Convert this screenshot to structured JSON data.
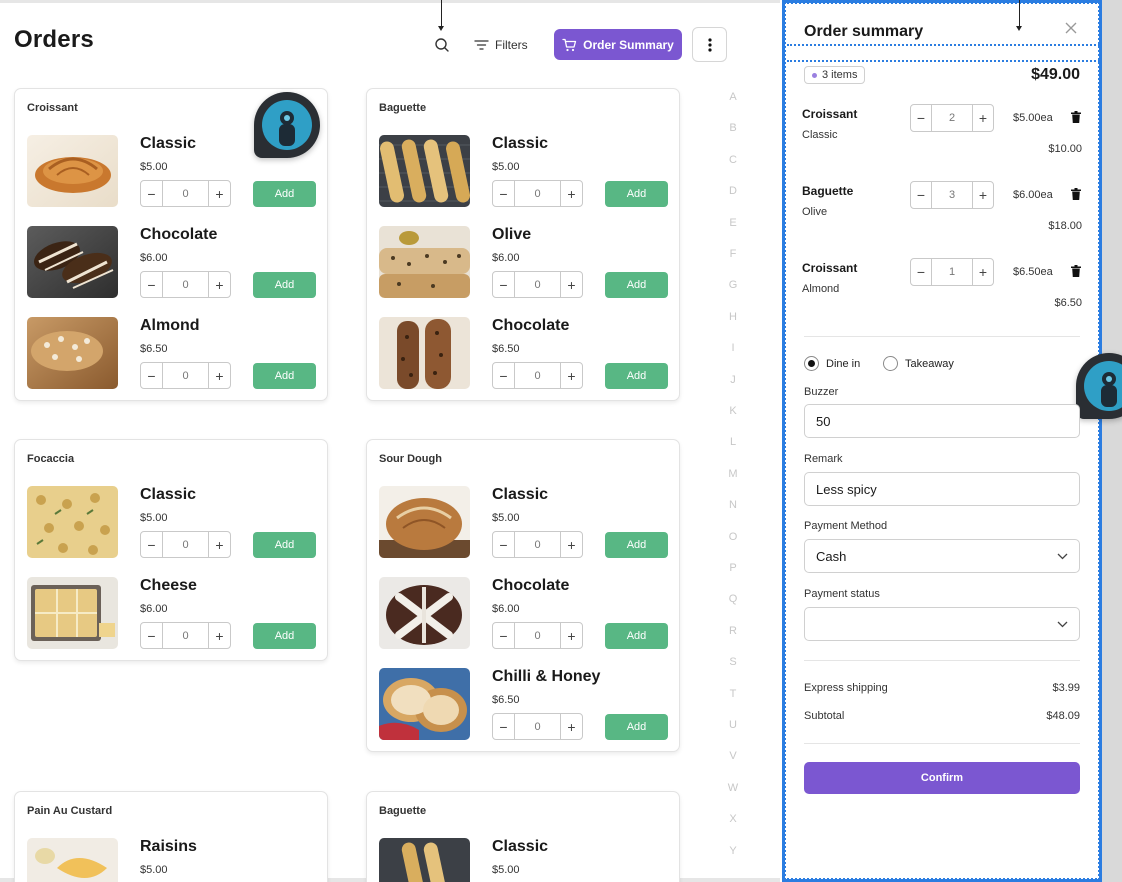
{
  "header": {
    "title": "Orders",
    "filters_label": "Filters",
    "summary_button_label": "Order Summary"
  },
  "categories": [
    {
      "title": "Croissant",
      "items": [
        {
          "name": "Classic",
          "price": "$5.00",
          "qty": "0",
          "add": "Add"
        },
        {
          "name": "Chocolate",
          "price": "$6.00",
          "qty": "0",
          "add": "Add"
        },
        {
          "name": "Almond",
          "price": "$6.50",
          "qty": "0",
          "add": "Add"
        }
      ]
    },
    {
      "title": "Baguette",
      "items": [
        {
          "name": "Classic",
          "price": "$5.00",
          "qty": "0",
          "add": "Add"
        },
        {
          "name": "Olive",
          "price": "$6.00",
          "qty": "0",
          "add": "Add"
        },
        {
          "name": "Chocolate",
          "price": "$6.50",
          "qty": "0",
          "add": "Add"
        }
      ]
    },
    {
      "title": "Focaccia",
      "items": [
        {
          "name": "Classic",
          "price": "$5.00",
          "qty": "0",
          "add": "Add"
        },
        {
          "name": "Cheese",
          "price": "$6.00",
          "qty": "0",
          "add": "Add"
        }
      ]
    },
    {
      "title": "Sour Dough",
      "items": [
        {
          "name": "Classic",
          "price": "$5.00",
          "qty": "0",
          "add": "Add"
        },
        {
          "name": "Chocolate",
          "price": "$6.00",
          "qty": "0",
          "add": "Add"
        },
        {
          "name": "Chilli & Honey",
          "price": "$6.50",
          "qty": "0",
          "add": "Add"
        }
      ]
    },
    {
      "title": "Pain Au Custard",
      "items": [
        {
          "name": "Raisins",
          "price": "$5.00"
        }
      ]
    },
    {
      "title": "Baguette",
      "items": [
        {
          "name": "Classic",
          "price": "$5.00"
        }
      ]
    }
  ],
  "alphabet": [
    "A",
    "B",
    "C",
    "D",
    "E",
    "F",
    "G",
    "H",
    "I",
    "J",
    "K",
    "L",
    "M",
    "N",
    "O",
    "P",
    "Q",
    "R",
    "S",
    "T",
    "U",
    "V",
    "W",
    "X",
    "Y"
  ],
  "order_summary": {
    "title": "Order summary",
    "items_badge": "3 items",
    "total": "$49.00",
    "lines": [
      {
        "name": "Croissant",
        "variant": "Classic",
        "qty": "2",
        "each": "$5.00ea",
        "line_total": "$10.00"
      },
      {
        "name": "Baguette",
        "variant": "Olive",
        "qty": "3",
        "each": "$6.00ea",
        "line_total": "$18.00"
      },
      {
        "name": "Croissant",
        "variant": "Almond",
        "qty": "1",
        "each": "$6.50ea",
        "line_total": "$6.50"
      }
    ],
    "dine_in_label": "Dine in",
    "takeaway_label": "Takeaway",
    "selected_service": "Dine in",
    "buzzer_label": "Buzzer",
    "buzzer_value": "50",
    "remark_label": "Remark",
    "remark_value": "Less spicy",
    "payment_method_label": "Payment Method",
    "payment_method_value": "Cash",
    "payment_status_label": "Payment status",
    "payment_status_value": "",
    "shipping_label": "Express shipping",
    "shipping_value": "$3.99",
    "subtotal_label": "Subtotal",
    "subtotal_value": "$48.09",
    "confirm_label": "Confirm"
  },
  "colors": {
    "accent": "#7b57d1",
    "add_button": "#58b784",
    "selection_outline": "#2b7de1"
  },
  "icons": [
    "search-icon",
    "filter-icon",
    "cart-icon",
    "more-vertical-icon",
    "close-icon",
    "trash-icon",
    "chevron-down-icon"
  ]
}
